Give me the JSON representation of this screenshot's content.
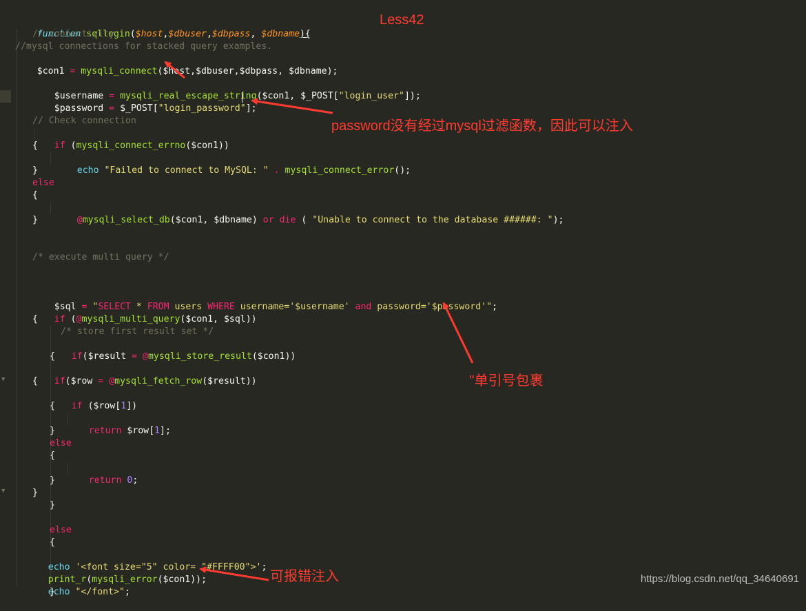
{
  "annotations": {
    "title": "Less42",
    "password_note": "password没有经过mysql过滤函数，因此可以注入",
    "quote_note": "''单引号包裹",
    "error_note": "可报错注入"
  },
  "watermark": "https://blog.csdn.net/qq_34640691",
  "code": {
    "l1": [
      "function",
      " ",
      "sqllogin",
      "(",
      "$host",
      ",",
      "$dbuser",
      ",",
      "$dbpass",
      ", ",
      "$dbname",
      "){"
    ],
    "l2": "// connectivity",
    "l3": "//mysql connections for stacked query examples.",
    "l4": [
      "$con1",
      " = ",
      "mysqli_connect",
      "($host,$dbuser,$dbpass, $dbname);"
    ],
    "l6": [
      "$username",
      " = ",
      "mysqli_real_escape_string",
      "($con1, $_POST[",
      "\"login_user\"",
      "]);"
    ],
    "l7": [
      "$password",
      " = ",
      "$_POST[",
      "\"login_password\"",
      "];"
    ],
    "l9": "// Check connection",
    "l10": [
      "if",
      " (",
      "mysqli_connect_errno",
      "($con1))"
    ],
    "l11": "{",
    "l12": [
      "echo",
      " ",
      "\"Failed to connect to MySQL: \"",
      " . ",
      "mysqli_connect_error",
      "();"
    ],
    "l13": "}",
    "l14": "else",
    "l15": "{",
    "l16": [
      "@",
      "mysqli_select_db",
      "($con1, $dbname) ",
      "or",
      " ",
      "die",
      " ( ",
      "\"Unable to connect to the database ######: \"",
      ");"
    ],
    "l17": "}",
    "l20": "/* execute multi query */",
    "l23": [
      "$sql",
      " = ",
      "\"",
      "SELECT",
      " * ",
      "FROM",
      " users ",
      "WHERE",
      " username='",
      "$username",
      "' ",
      "and",
      " password='",
      "$password",
      "'\"",
      ";"
    ],
    "l24": [
      "if",
      " (",
      "@",
      "mysqli_multi_query",
      "($con1, $sql))"
    ],
    "l25": "{",
    "l26": "/* store first result set */",
    "l27": [
      "if",
      "($result",
      " = ",
      "@",
      "mysqli_store_result",
      "($con1))"
    ],
    "l28": "{",
    "l29": [
      "if",
      "($row",
      " = ",
      "@",
      "mysqli_fetch_row",
      "($result))"
    ],
    "l30": "{",
    "l31": [
      "if",
      " ($row[",
      "1",
      "])"
    ],
    "l32": "{",
    "l33": [
      "return",
      " $row[",
      "1",
      "];"
    ],
    "l34": "}",
    "l35": "else",
    "l36": "{",
    "l37": [
      "return",
      " ",
      "0",
      ";"
    ],
    "l38": "}",
    "l39": "}",
    "l40": "}",
    "l42": "else",
    "l43": "{",
    "l44": [
      "echo",
      " ",
      "'<font size=\"5\" color= \"#FFFF00\">'",
      ";"
    ],
    "l45": [
      "print_r",
      "(",
      "mysqli_error",
      "($con1));"
    ],
    "l46": [
      "echo",
      " ",
      "\"</font>\"",
      ";"
    ],
    "l47": "}"
  },
  "colors": {
    "background": "#272822",
    "annotation": "#ff3b30",
    "keyword": "#66d9ef",
    "function": "#a6e22e",
    "string": "#e6db74",
    "operator": "#f92672",
    "comment": "#75715e",
    "number": "#ae81ff",
    "parameter": "#fd971f"
  }
}
